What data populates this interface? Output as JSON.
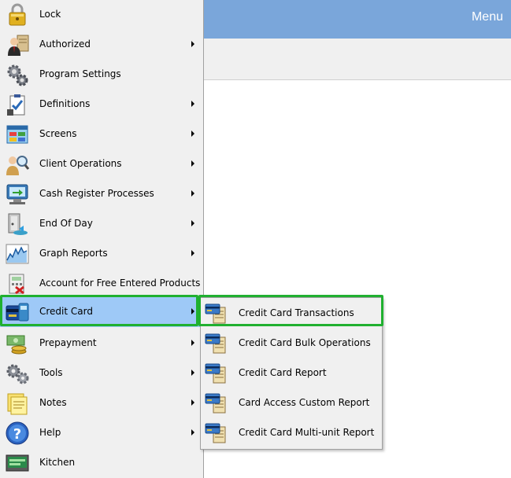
{
  "header": {
    "title": "Menu"
  },
  "accent_color": "#7aa6da",
  "highlight_color": "#20b030",
  "menu": [
    {
      "label": "Lock",
      "icon": "padlock-icon",
      "submenu": false
    },
    {
      "label": "Authorized",
      "icon": "authorized-users-icon",
      "submenu": true
    },
    {
      "label": "Program Settings",
      "icon": "settings-gears-icon",
      "submenu": false
    },
    {
      "label": "Definitions",
      "icon": "clipboard-check-icon",
      "submenu": true
    },
    {
      "label": "Screens",
      "icon": "screens-window-icon",
      "submenu": true
    },
    {
      "label": "Client Operations",
      "icon": "client-search-icon",
      "submenu": true
    },
    {
      "label": "Cash Register Processes",
      "icon": "cash-register-monitor-icon",
      "submenu": true
    },
    {
      "label": "End Of Day",
      "icon": "end-of-day-door-icon",
      "submenu": true
    },
    {
      "label": "Graph Reports",
      "icon": "line-graph-icon",
      "submenu": true
    },
    {
      "label": "Account for Free Entered Products",
      "icon": "account-calculator-icon",
      "submenu": false
    },
    {
      "label": "Credit Card",
      "icon": "credit-card-terminal-icon",
      "submenu": true,
      "active": true
    },
    {
      "label": "Prepayment",
      "icon": "money-coins-icon",
      "submenu": true
    },
    {
      "label": "Tools",
      "icon": "tools-gears-icon",
      "submenu": true
    },
    {
      "label": "Notes",
      "icon": "sticky-notes-icon",
      "submenu": true
    },
    {
      "label": "Help",
      "icon": "help-question-icon",
      "submenu": true
    },
    {
      "label": "Kitchen",
      "icon": "kitchen-screen-icon",
      "submenu": false
    }
  ],
  "credit_card_submenu": [
    {
      "label": "Credit Card Transactions",
      "icon": "credit-card-document-icon",
      "highlighted": true
    },
    {
      "label": "Credit Card Bulk Operations",
      "icon": "credit-card-document-icon"
    },
    {
      "label": "Credit Card Report",
      "icon": "credit-card-document-icon"
    },
    {
      "label": "Card Access Custom Report",
      "icon": "credit-card-document-icon"
    },
    {
      "label": "Credit Card Multi-unit Report",
      "icon": "credit-card-document-icon"
    }
  ]
}
